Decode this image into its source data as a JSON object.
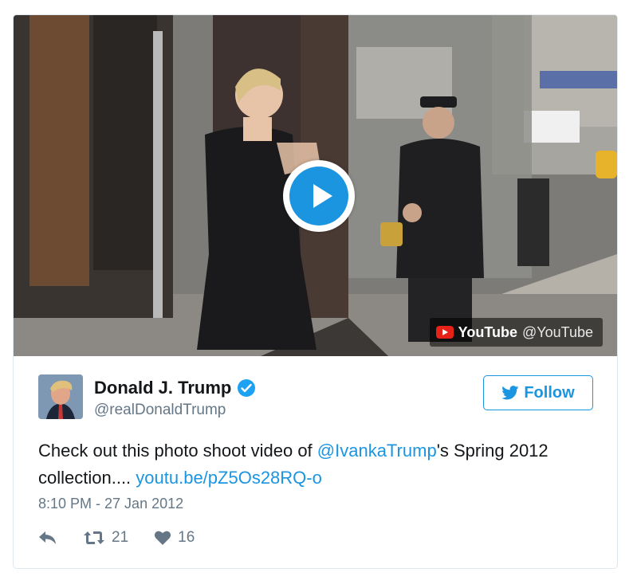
{
  "video": {
    "provider": "YouTube",
    "provider_handle": "@YouTube",
    "play_icon": "play-icon",
    "accent_color": "#1b95e0"
  },
  "author": {
    "display_name": "Donald J. Trump",
    "handle": "@realDonaldTrump",
    "verified": true,
    "verified_icon": "verified-badge-icon"
  },
  "follow_button": {
    "label": "Follow",
    "icon": "twitter-bird-icon"
  },
  "tweet": {
    "text_before": "Check out this photo shoot video of ",
    "mention": "@IvankaTrump",
    "text_middle": "'s Spring 2012 collection.... ",
    "link": "youtu.be/pZ5Os28RQ-o",
    "timestamp": "8:10 PM - 27 Jan 2012"
  },
  "actions": {
    "reply_icon": "reply-icon",
    "retweet_icon": "retweet-icon",
    "retweet_count": "21",
    "like_icon": "heart-icon",
    "like_count": "16"
  },
  "colors": {
    "link": "#1b95e0",
    "muted": "#657786",
    "text": "#14171a",
    "border": "#e1e8ed"
  }
}
